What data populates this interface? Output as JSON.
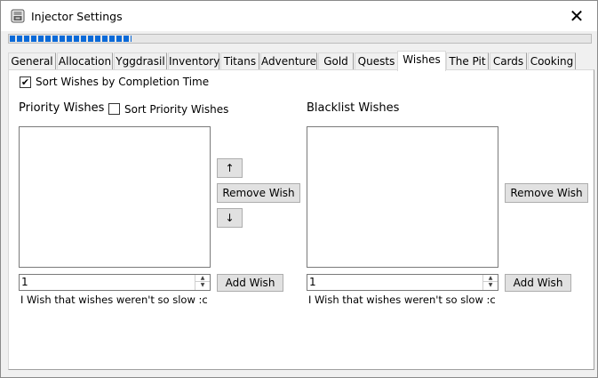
{
  "window": {
    "title": "Injector Settings",
    "close_glyph": "✕",
    "app_icon": "injector-app-icon"
  },
  "progress": {
    "value_percent": 21
  },
  "tabs": [
    {
      "label": "General"
    },
    {
      "label": "Allocation"
    },
    {
      "label": "Yggdrasil"
    },
    {
      "label": "Inventory"
    },
    {
      "label": "Titans"
    },
    {
      "label": "Adventure"
    },
    {
      "label": "Gold"
    },
    {
      "label": "Quests"
    },
    {
      "label": "Wishes",
      "selected": true
    },
    {
      "label": "The Pit"
    },
    {
      "label": "Cards"
    },
    {
      "label": "Cooking"
    }
  ],
  "wishes": {
    "sort_by_completion": {
      "label": "Sort Wishes by Completion Time",
      "checked": true,
      "mark": "✔"
    },
    "priority": {
      "heading": "Priority Wishes",
      "sort_label": "Sort Priority Wishes",
      "sort_checked": false,
      "items": [],
      "move_up_label": "↑",
      "remove_label": "Remove Wish",
      "move_down_label": "↓",
      "input_value": "1",
      "add_label": "Add Wish",
      "wish_name": "I Wish that wishes weren't so slow :c"
    },
    "blacklist": {
      "heading": "Blacklist Wishes",
      "items": [],
      "remove_label": "Remove Wish",
      "input_value": "1",
      "add_label": "Add Wish",
      "wish_name": "I Wish that wishes weren't so slow :c"
    }
  },
  "spinner": {
    "up_glyph": "▲",
    "down_glyph": "▼"
  }
}
